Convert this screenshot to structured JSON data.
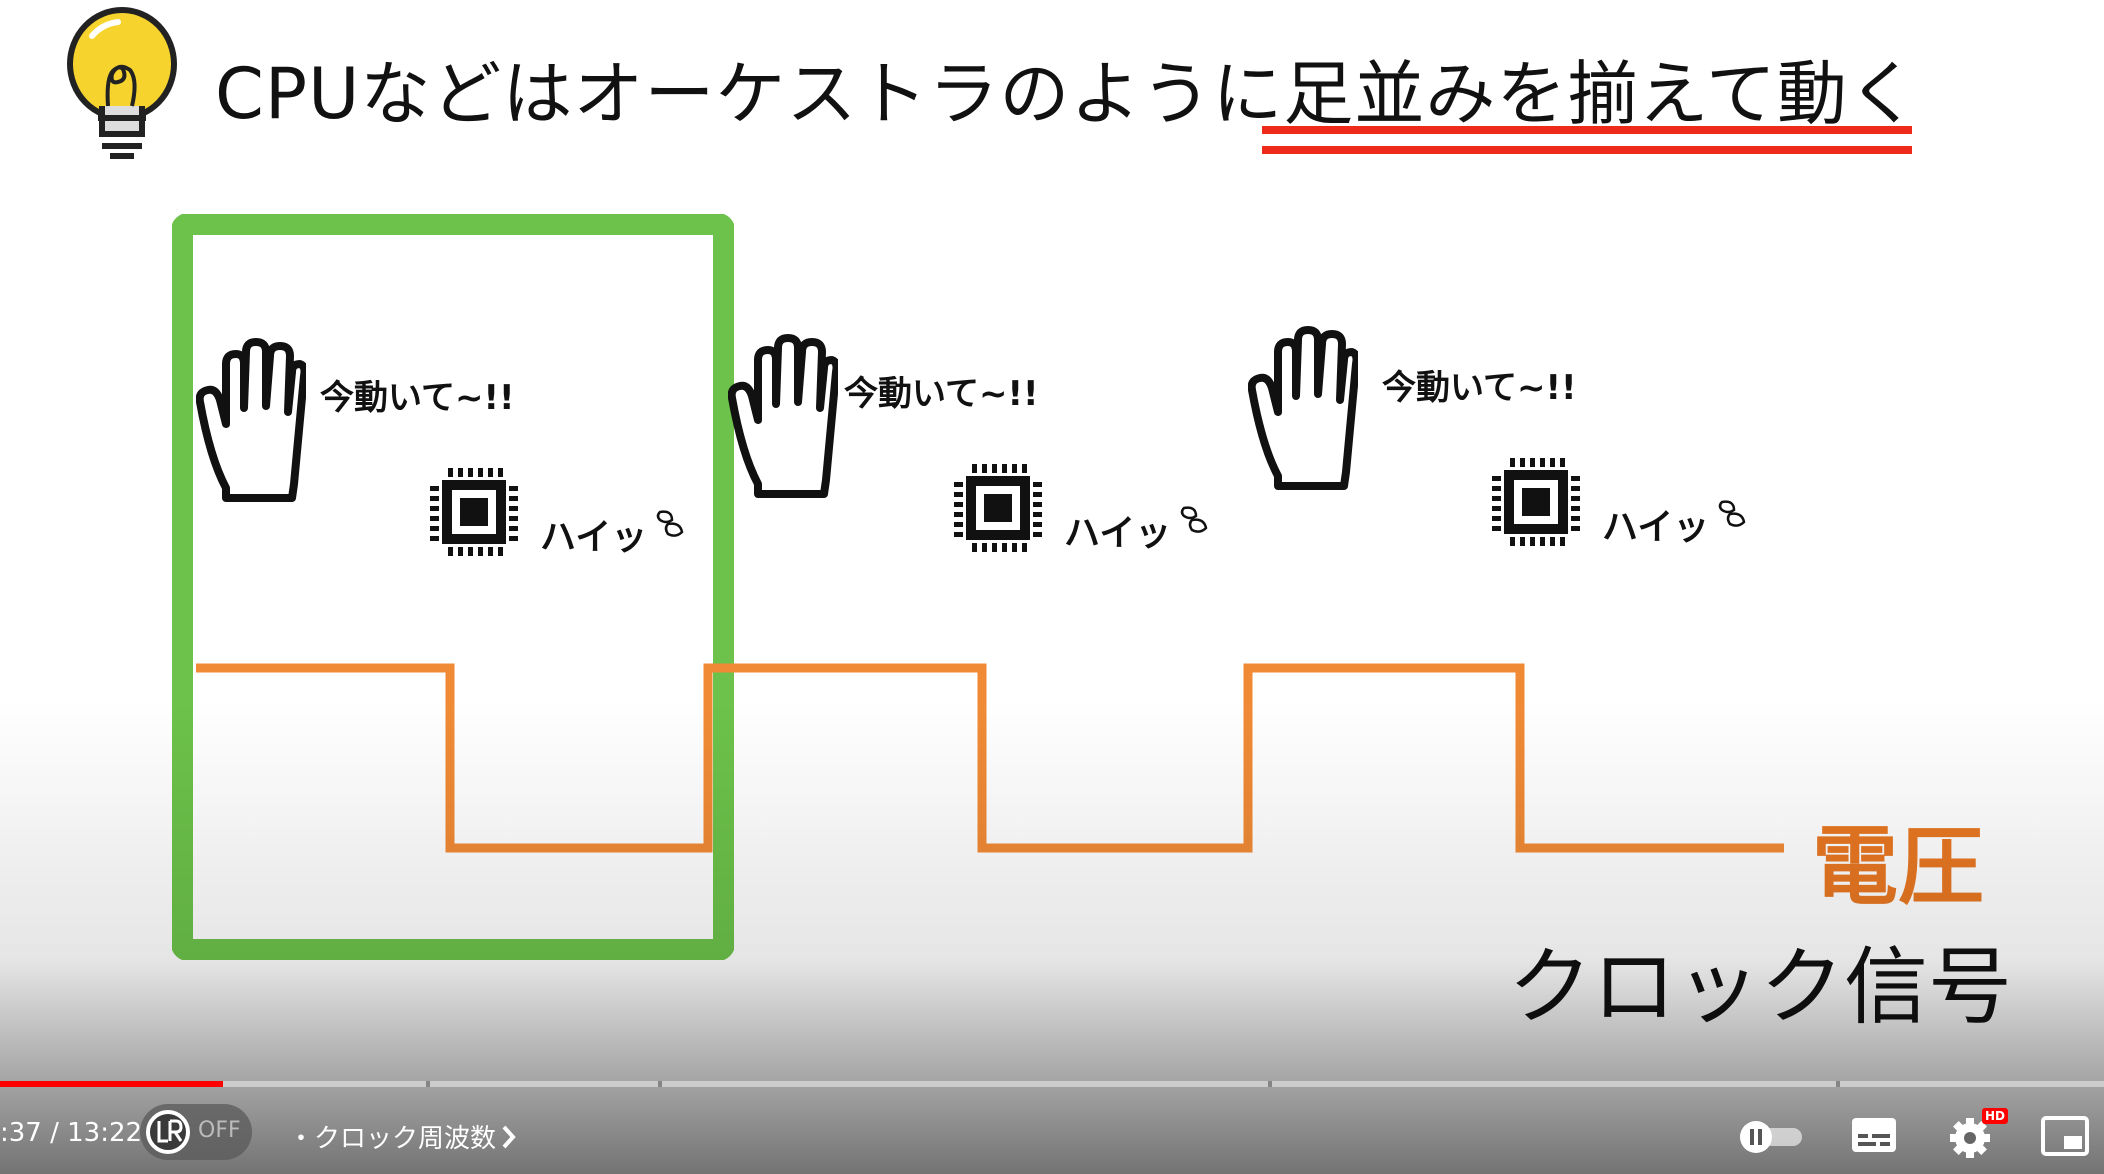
{
  "slide": {
    "title": "CPUなどはオーケストラのように足並みを揃えて動く",
    "callouts": [
      "今動いて~!!",
      "今動いて~!!",
      "今動いて~!!"
    ],
    "replies": [
      "ハイッ",
      "ハイッ",
      "ハイッ"
    ],
    "voltage_label": "電圧",
    "clock_label": "クロック信号",
    "colors": {
      "highlight_box": "#6cc24a",
      "signal_line": "#f08a35",
      "underline": "#ee2a1b",
      "bulb": "#f6d32d"
    },
    "icons": [
      "lightbulb-icon",
      "hand-icon",
      "cpu-chip-icon",
      "sweat-drop-icon"
    ]
  },
  "player": {
    "time": ":37 / 13:22",
    "lr_toggle": "OFF",
    "chapter": "・クロック周波数",
    "progress_fraction": 0.106,
    "colors": {
      "progress": "#ff0000",
      "hd_badge": "#ff0000"
    },
    "hd_badge": "HD",
    "icons": [
      "chevron-right-icon",
      "autoplay-toggle-icon",
      "subtitles-icon",
      "settings-gear-icon",
      "miniplayer-icon"
    ]
  }
}
